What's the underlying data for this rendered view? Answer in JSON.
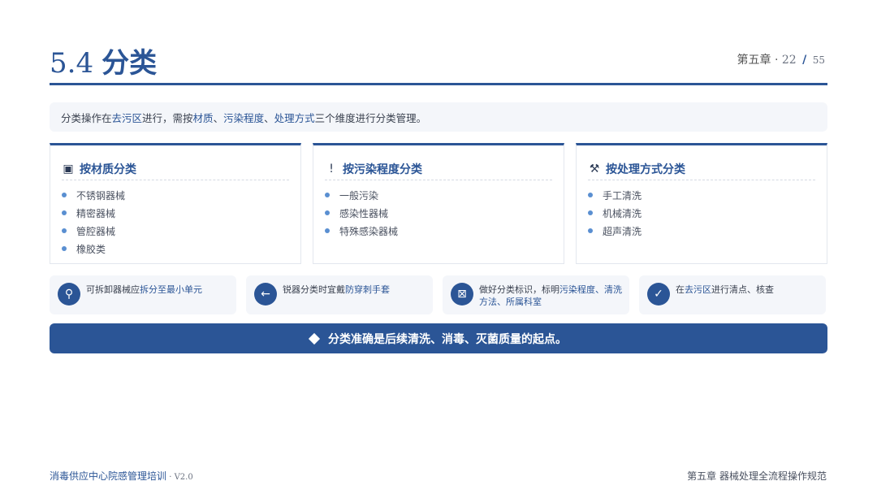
{
  "header": {
    "section_number": "5.4",
    "title": "分类",
    "chapter_label": "第五章 ·",
    "current_page": "22",
    "page_separator": "/",
    "total_pages": "55"
  },
  "intro": {
    "parts": [
      "分类操作在",
      "去污区",
      "进行，需按",
      "材质",
      "、",
      "污染程度",
      "、",
      "处理方式",
      "三个维度进行分类管理。"
    ]
  },
  "cards": [
    {
      "icon": "square-box-icon",
      "icon_glyph": "▣",
      "title": "按材质分类",
      "items": [
        "不锈钢器械",
        "精密器械",
        "管腔器械",
        "橡胶类"
      ]
    },
    {
      "icon": "exclamation-icon",
      "icon_glyph": "!",
      "title": "按污染程度分类",
      "items": [
        "一般污染",
        "感染性器械",
        "特殊感染器械"
      ]
    },
    {
      "icon": "tools-icon",
      "icon_glyph": "⚒",
      "title": "按处理方式分类",
      "items": [
        "手工清洗",
        "机械清洗",
        "超声清洗"
      ]
    }
  ],
  "tips": [
    {
      "icon": "search-icon",
      "icon_glyph": "⚲",
      "parts": [
        "可拆卸器械应",
        "拆分至最小单元",
        ""
      ]
    },
    {
      "icon": "arrow-left-icon",
      "icon_glyph": "←",
      "parts": [
        "锐器分类时宜戴",
        "防穿刺手套",
        ""
      ]
    },
    {
      "icon": "label-box-icon",
      "icon_glyph": "⊠",
      "parts": [
        "做好分类标识，标明",
        "污染程度、清洗方法、所属科室",
        ""
      ]
    },
    {
      "icon": "check-icon",
      "icon_glyph": "✓",
      "parts": [
        "在",
        "去污区",
        "进行清点、核查"
      ]
    }
  ],
  "banner": {
    "text": "分类准确是后续清洗、消毒、灭菌质量的起点。"
  },
  "footer": {
    "left": "消毒供应中心院感管理培训",
    "left_sep": " · ",
    "version": "V2.0",
    "right": "第五章 器械处理全流程操作规范"
  },
  "colors": {
    "accent": "#2b5596",
    "bullet": "#5a8fd1",
    "panel_bg": "#f4f6fa"
  }
}
